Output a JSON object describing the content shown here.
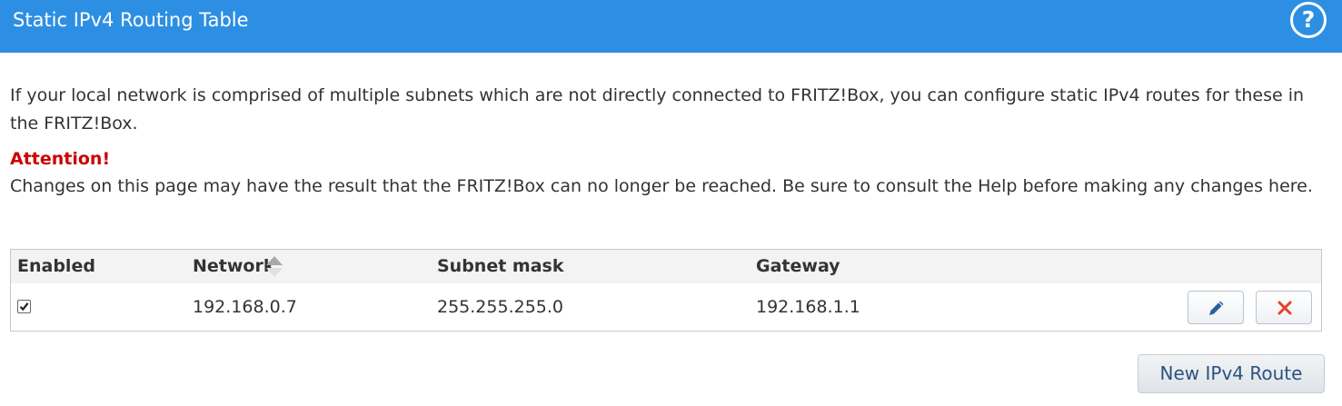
{
  "header": {
    "title": "Static IPv4 Routing Table",
    "help_icon": "question-mark-icon",
    "help_label": "?"
  },
  "intro": {
    "text": "If your local network is comprised of multiple subnets which are not directly connected to FRITZ!Box, you can configure static IPv4 routes for these in the FRITZ!Box."
  },
  "attention": {
    "heading": "Attention!",
    "text": "Changes on this page may have the result that the FRITZ!Box can no longer be reached. Be sure to consult the Help before making any changes here."
  },
  "table": {
    "columns": {
      "enabled": "Enabled",
      "network": "Network",
      "subnet_mask": "Subnet mask",
      "gateway": "Gateway"
    },
    "sort_icon": "sort-arrows-icon",
    "rows": [
      {
        "enabled": true,
        "network": "192.168.0.7",
        "subnet_mask": "255.255.255.0",
        "gateway": "192.168.1.1",
        "edit_icon": "pencil-icon",
        "delete_icon": "close-x-icon"
      }
    ]
  },
  "actions": {
    "new_route_label": "New IPv4 Route"
  },
  "colors": {
    "header_bg": "#2d8fe3",
    "attention": "#cc0000",
    "edit_icon": "#2a5f9e",
    "delete_icon": "#e8402a",
    "button_text": "#2a5382"
  }
}
